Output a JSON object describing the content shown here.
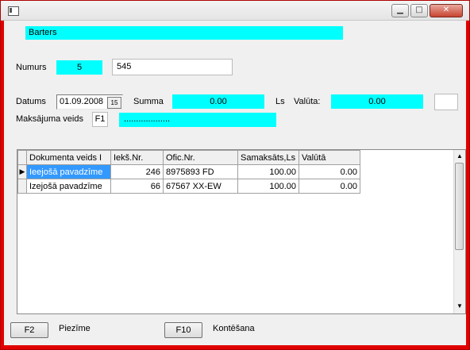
{
  "window": {
    "minimize": "▁",
    "maximize": "□",
    "close": "✕"
  },
  "form": {
    "header_value": "Barters",
    "numurs_label": "Numurs",
    "numurs_value": "5",
    "numurs_value2": "545",
    "datums_label": "Datums",
    "datums_value": "01.09.2008",
    "calendar_glyph": "15",
    "summa_label": "Summa",
    "summa_value": "0.00",
    "currency_label": "Ls",
    "valuta_label": "Valūta:",
    "valuta_value": "0.00",
    "valuta_extra": "",
    "payment_label": "Maksājuma veids",
    "payment_code": "F1",
    "payment_value": "..................."
  },
  "grid": {
    "columns": [
      "Dokumenta veids I",
      "Iekš.Nr.",
      "Ofic.Nr.",
      "Samaksāts,Ls",
      "Valūtā"
    ],
    "rows": [
      {
        "doc": "Ieejošā pavadzīme",
        "iek": "246",
        "ofic": "8975893 FD",
        "sam": "100.00",
        "val": "0.00"
      },
      {
        "doc": "Izejošā pavadzīme",
        "iek": "66",
        "ofic": "67567 XX-EW",
        "sam": "100.00",
        "val": "0.00"
      }
    ]
  },
  "footer": {
    "f2_label": "F2",
    "f2_text": "Piezīme",
    "f10_label": "F10",
    "f10_text": "Kontēšana"
  }
}
